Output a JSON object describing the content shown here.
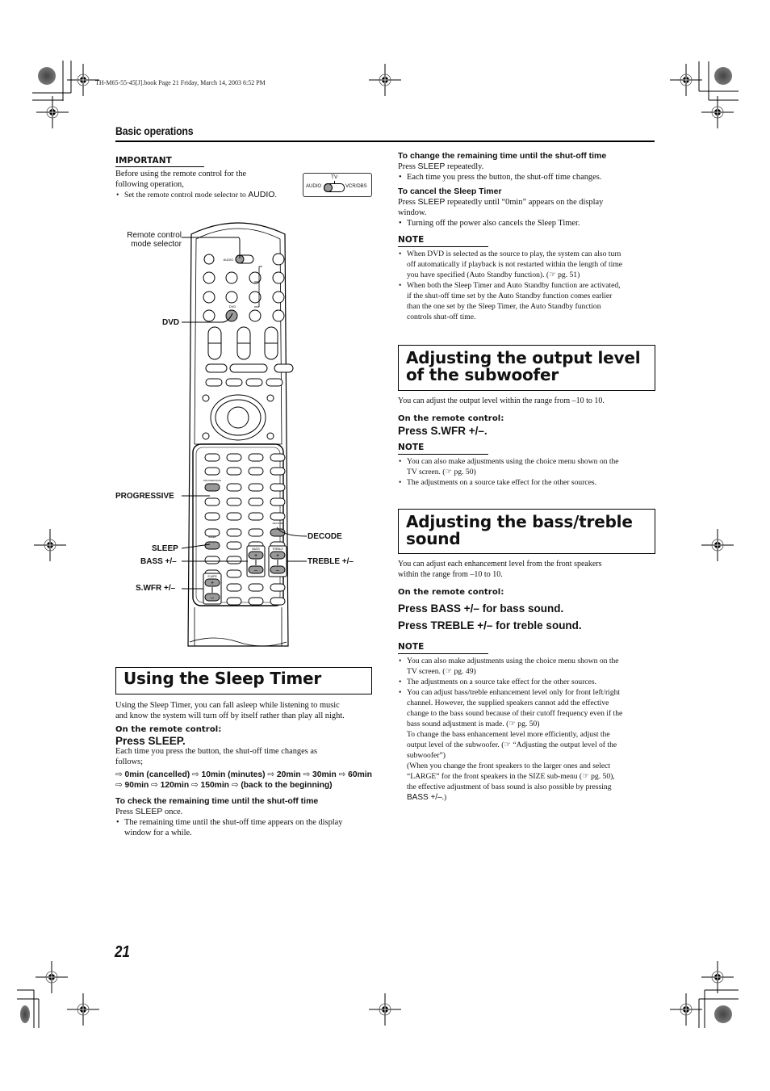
{
  "print_marks": {
    "book_line": "TH-M65-55-45[J].book  Page 21  Friday, March 14, 2003  6:52 PM"
  },
  "header": {
    "section": "Basic operations"
  },
  "important": {
    "label": "IMPORTANT",
    "text_line1": "Before using the remote control for the",
    "text_line2": "following operation,",
    "bullet_prefix": "Set the remote control mode selector to ",
    "bullet_keyword": "AUDIO",
    "bullet_suffix": ".",
    "selector_diagram": {
      "left_label": "AUDIO",
      "top_label": "TV",
      "right_label": "VCR/DBS"
    }
  },
  "remote_diagram": {
    "callouts": {
      "mode_selector_line1": "Remote control",
      "mode_selector_line2": "mode selector",
      "dvd": "DVD",
      "progressive": "PROGRESSIVE",
      "sleep": "SLEEP",
      "bass": "BASS +/–",
      "swfr": "S.WFR +/–",
      "decode": "DECODE",
      "treble": "TREBLE +/–"
    },
    "button_labels": {
      "audio": "AUDIO",
      "dvd": "DVD",
      "progressive": "PROGRESSIVE",
      "decode": "DECODE",
      "sleep": "SLEEP",
      "bass": "BASS",
      "treble": "TREBLE",
      "swfr": "S.WFR",
      "plus": "+",
      "minus": "–"
    }
  },
  "sleep_timer": {
    "title": "Using the Sleep Timer",
    "intro_line1": "Using the Sleep Timer, you can fall asleep while listening to music",
    "intro_line2": "and know the system will turn off by itself rather than play all night.",
    "on_remote": "On the remote control:",
    "press": "Press SLEEP.",
    "each_time_line1": "Each time you press the button, the shut-off time changes as",
    "each_time_line2": "follows;",
    "sequence": [
      "0min (cancelled)",
      "10min (minutes)",
      "20min",
      "30min",
      "60min",
      "90min",
      "120min",
      "150min",
      "(back to the beginning)"
    ],
    "arrow_glyph": "⇨",
    "check": {
      "heading": "To check the remaining time until the shut-off time",
      "press_prefix": "Press ",
      "press_keyword": "SLEEP",
      "press_suffix": " once.",
      "bullet_line1": "The remaining time until the shut-off time appears on the display",
      "bullet_line2": "window for a while."
    },
    "change": {
      "heading": "To change the remaining time until the shut-off time",
      "press_prefix": "Press ",
      "press_keyword": "SLEEP",
      "press_suffix": " repeatedly.",
      "bullet": "Each time you press the button, the shut-off time changes."
    },
    "cancel": {
      "heading": "To cancel the Sleep Timer",
      "press_prefix": "Press ",
      "press_keyword": "SLEEP",
      "press_suffix_line1": " repeatedly until “0min” appears on the display",
      "press_suffix_line2": "window.",
      "bullet": "Turning off the power also cancels the Sleep Timer."
    },
    "note": {
      "label": "NOTE",
      "bullets": [
        [
          "When DVD is selected as the source to play, the system can also turn",
          "off automatically if playback is not restarted within the length of time",
          "you have specified (Auto Standby function). (☞ pg. 51)"
        ],
        [
          "When both the Sleep Timer and Auto Standby function are activated,",
          "if the shut-off time set by the Auto Standby function comes earlier",
          "than the one set by the Sleep Timer, the Auto Standby function",
          "controls shut-off time."
        ]
      ]
    }
  },
  "subwoofer": {
    "title_line1": "Adjusting the output level",
    "title_line2": "of the subwoofer",
    "intro": "You can adjust the output level within the range from –10 to 10.",
    "on_remote": "On the remote control:",
    "press": "Press S.WFR +/–.",
    "note": {
      "label": "NOTE",
      "bullets": [
        [
          "You can also make adjustments using the choice menu shown on the",
          "TV screen. (☞ pg. 50)"
        ],
        [
          "The adjustments on a source take effect for the other sources."
        ]
      ]
    }
  },
  "bass_treble": {
    "title_line1": "Adjusting the bass/treble",
    "title_line2": "sound",
    "intro_line1": "You can adjust each enhancement level from the front speakers",
    "intro_line2": "within the range from –10 to 10.",
    "on_remote": "On the remote control:",
    "press_bass": "Press BASS +/– for bass sound.",
    "press_treble": "Press TREBLE +/– for treble sound.",
    "note": {
      "label": "NOTE",
      "bullet1": [
        "You can also make adjustments using the choice menu shown on the",
        "TV screen. (☞ pg. 49)"
      ],
      "bullet2": [
        "The adjustments on a source take effect for the other sources."
      ],
      "bullet3": [
        "You can adjust bass/treble enhancement level only for front left/right",
        "channel. However, the supplied speakers cannot add the effective",
        "change to the bass sound because of their cutoff frequency even if the",
        "bass sound adjustment is made. (☞ pg. 50)",
        "To change the bass enhancement level more efficiently, adjust the",
        "output level of the subwoofer. (☞ “Adjusting the output level of the",
        "subwoofer”)",
        "(When you change the front speakers to the larger ones and select",
        "“LARGE” for the front speakers in the SIZE sub-menu (☞ pg. 50),",
        "the effective adjustment of bass sound is also possible by pressing"
      ],
      "bullet3_last_keyword": "BASS +/–",
      "bullet3_last_suffix": ".)"
    }
  },
  "footer": {
    "page_number": "21"
  }
}
